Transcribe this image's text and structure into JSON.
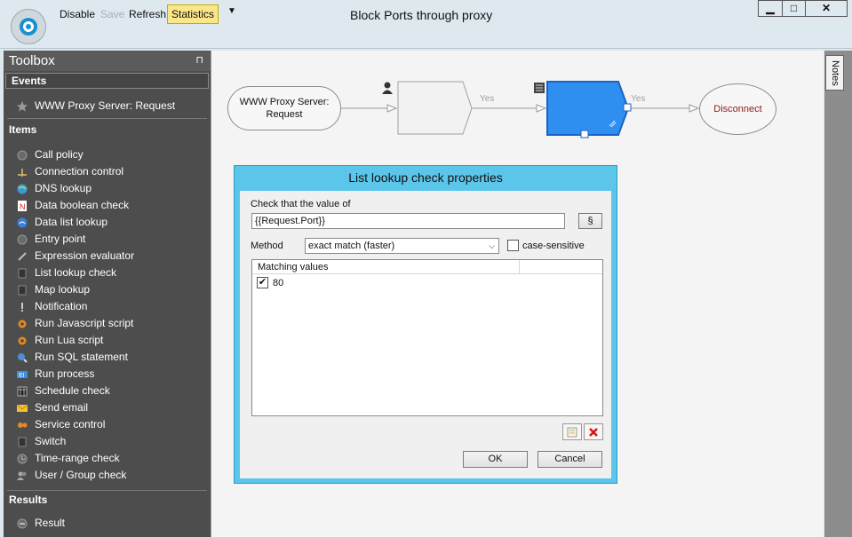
{
  "window": {
    "title": "Block Ports through proxy",
    "controls": {
      "minimize": "▁",
      "maximize": "□",
      "close": "✕"
    }
  },
  "toolbar": {
    "disable_label": "Disable",
    "save_label": "Save",
    "refresh_label": "Refresh",
    "statistics_label": "Statistics",
    "dropdown_glyph": "▼"
  },
  "toolbox": {
    "title": "Toolbox",
    "pin_glyph": "⊓",
    "events_header": "Events",
    "events": [
      {
        "label": "WWW Proxy Server: Request",
        "icon": "star-icon"
      }
    ],
    "items_header": "Items",
    "items": [
      {
        "label": "Call policy",
        "icon": "call-policy-icon"
      },
      {
        "label": "Connection control",
        "icon": "connection-control-icon"
      },
      {
        "label": "DNS lookup",
        "icon": "dns-lookup-icon"
      },
      {
        "label": "Data boolean check",
        "icon": "data-boolean-icon"
      },
      {
        "label": "Data list lookup",
        "icon": "data-list-icon"
      },
      {
        "label": "Entry point",
        "icon": "entry-point-icon"
      },
      {
        "label": "Expression evaluator",
        "icon": "expression-icon"
      },
      {
        "label": "List lookup check",
        "icon": "list-lookup-icon"
      },
      {
        "label": "Map lookup",
        "icon": "map-lookup-icon"
      },
      {
        "label": "Notification",
        "icon": "notification-icon"
      },
      {
        "label": "Run Javascript script",
        "icon": "gear-icon"
      },
      {
        "label": "Run Lua script",
        "icon": "gear-icon"
      },
      {
        "label": "Run SQL statement",
        "icon": "sql-icon"
      },
      {
        "label": "Run process",
        "icon": "process-icon"
      },
      {
        "label": "Schedule check",
        "icon": "calendar-icon"
      },
      {
        "label": "Send email",
        "icon": "envelope-icon"
      },
      {
        "label": "Service control",
        "icon": "service-icon"
      },
      {
        "label": "Switch",
        "icon": "switch-icon"
      },
      {
        "label": "Time-range check",
        "icon": "clock-icon"
      },
      {
        "label": "User / Group check",
        "icon": "user-group-icon"
      }
    ],
    "results_header": "Results",
    "results": [
      {
        "label": "Result",
        "icon": "result-icon"
      }
    ]
  },
  "flow": {
    "start_node": "WWW Proxy Server:\nRequest",
    "yes_label_1": "Yes",
    "yes_label_2": "Yes",
    "end_node": "Disconnect"
  },
  "notes": {
    "tab_label": "Notes"
  },
  "dialog": {
    "title": "List lookup check properties",
    "check_label": "Check that the value of",
    "value_input": "{{Request.Port}}",
    "section_button": "§",
    "method_label": "Method",
    "method_value": "exact match (faster)",
    "case_sensitive_label": "case-sensitive",
    "case_sensitive_checked": false,
    "matching_header": "Matching values",
    "matching_values": [
      {
        "value": "80",
        "checked": true
      }
    ],
    "ok_label": "OK",
    "cancel_label": "Cancel"
  },
  "colors": {
    "accent": "#5cc6ea",
    "selected_node": "#2f8ff0",
    "statistics_bg": "#fbe78a",
    "toolbox_bg": "#4d4d4d",
    "disconnect_text": "#8b1a1a"
  }
}
